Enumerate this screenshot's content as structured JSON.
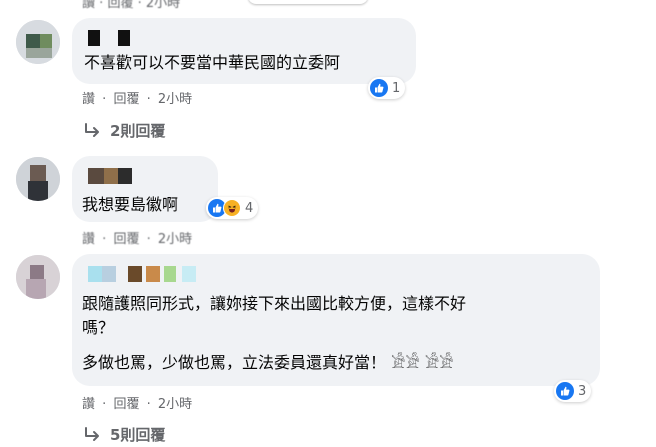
{
  "top_partial": {
    "actions": {
      "reply": "讀",
      "sep": "·",
      "reply2": "回覆",
      "time": "2小時"
    }
  },
  "comments": [
    {
      "text_lines": [
        "不喜歡可以不要當中華民國的立委阿"
      ],
      "reactions": {
        "count": "1",
        "types": [
          "like"
        ]
      },
      "actions": {
        "reply": "讚",
        "sep": "·",
        "reply2": "回覆",
        "time": "2小時"
      },
      "replies_label": "2則回覆"
    },
    {
      "text_lines": [
        "我想要島徽啊"
      ],
      "reactions": {
        "count": "4",
        "types": [
          "like",
          "haha"
        ]
      },
      "actions": {
        "reply": "讚",
        "sep": "·",
        "reply2": "回覆",
        "time": "2小時"
      }
    },
    {
      "text_lines": [
        "跟隨護照同形式，讓妳接下來出國比較方便，這樣不好",
        "嗎？",
        "多做也罵，少做也罵，立法委員還真好當！ 𓀀𓀀 𓀀𓀀"
      ],
      "reactions": {
        "count": "3",
        "types": [
          "like"
        ]
      },
      "actions": {
        "reply": "讚",
        "sep": "·",
        "reply2": "回覆",
        "time": "2小時"
      },
      "replies_label": "5則回覆"
    }
  ],
  "colors": {
    "bubble": "#f0f2f5",
    "secondary_text": "#65676b",
    "like_blue": "#1877f2",
    "haha_yellow": "#f7b125"
  }
}
